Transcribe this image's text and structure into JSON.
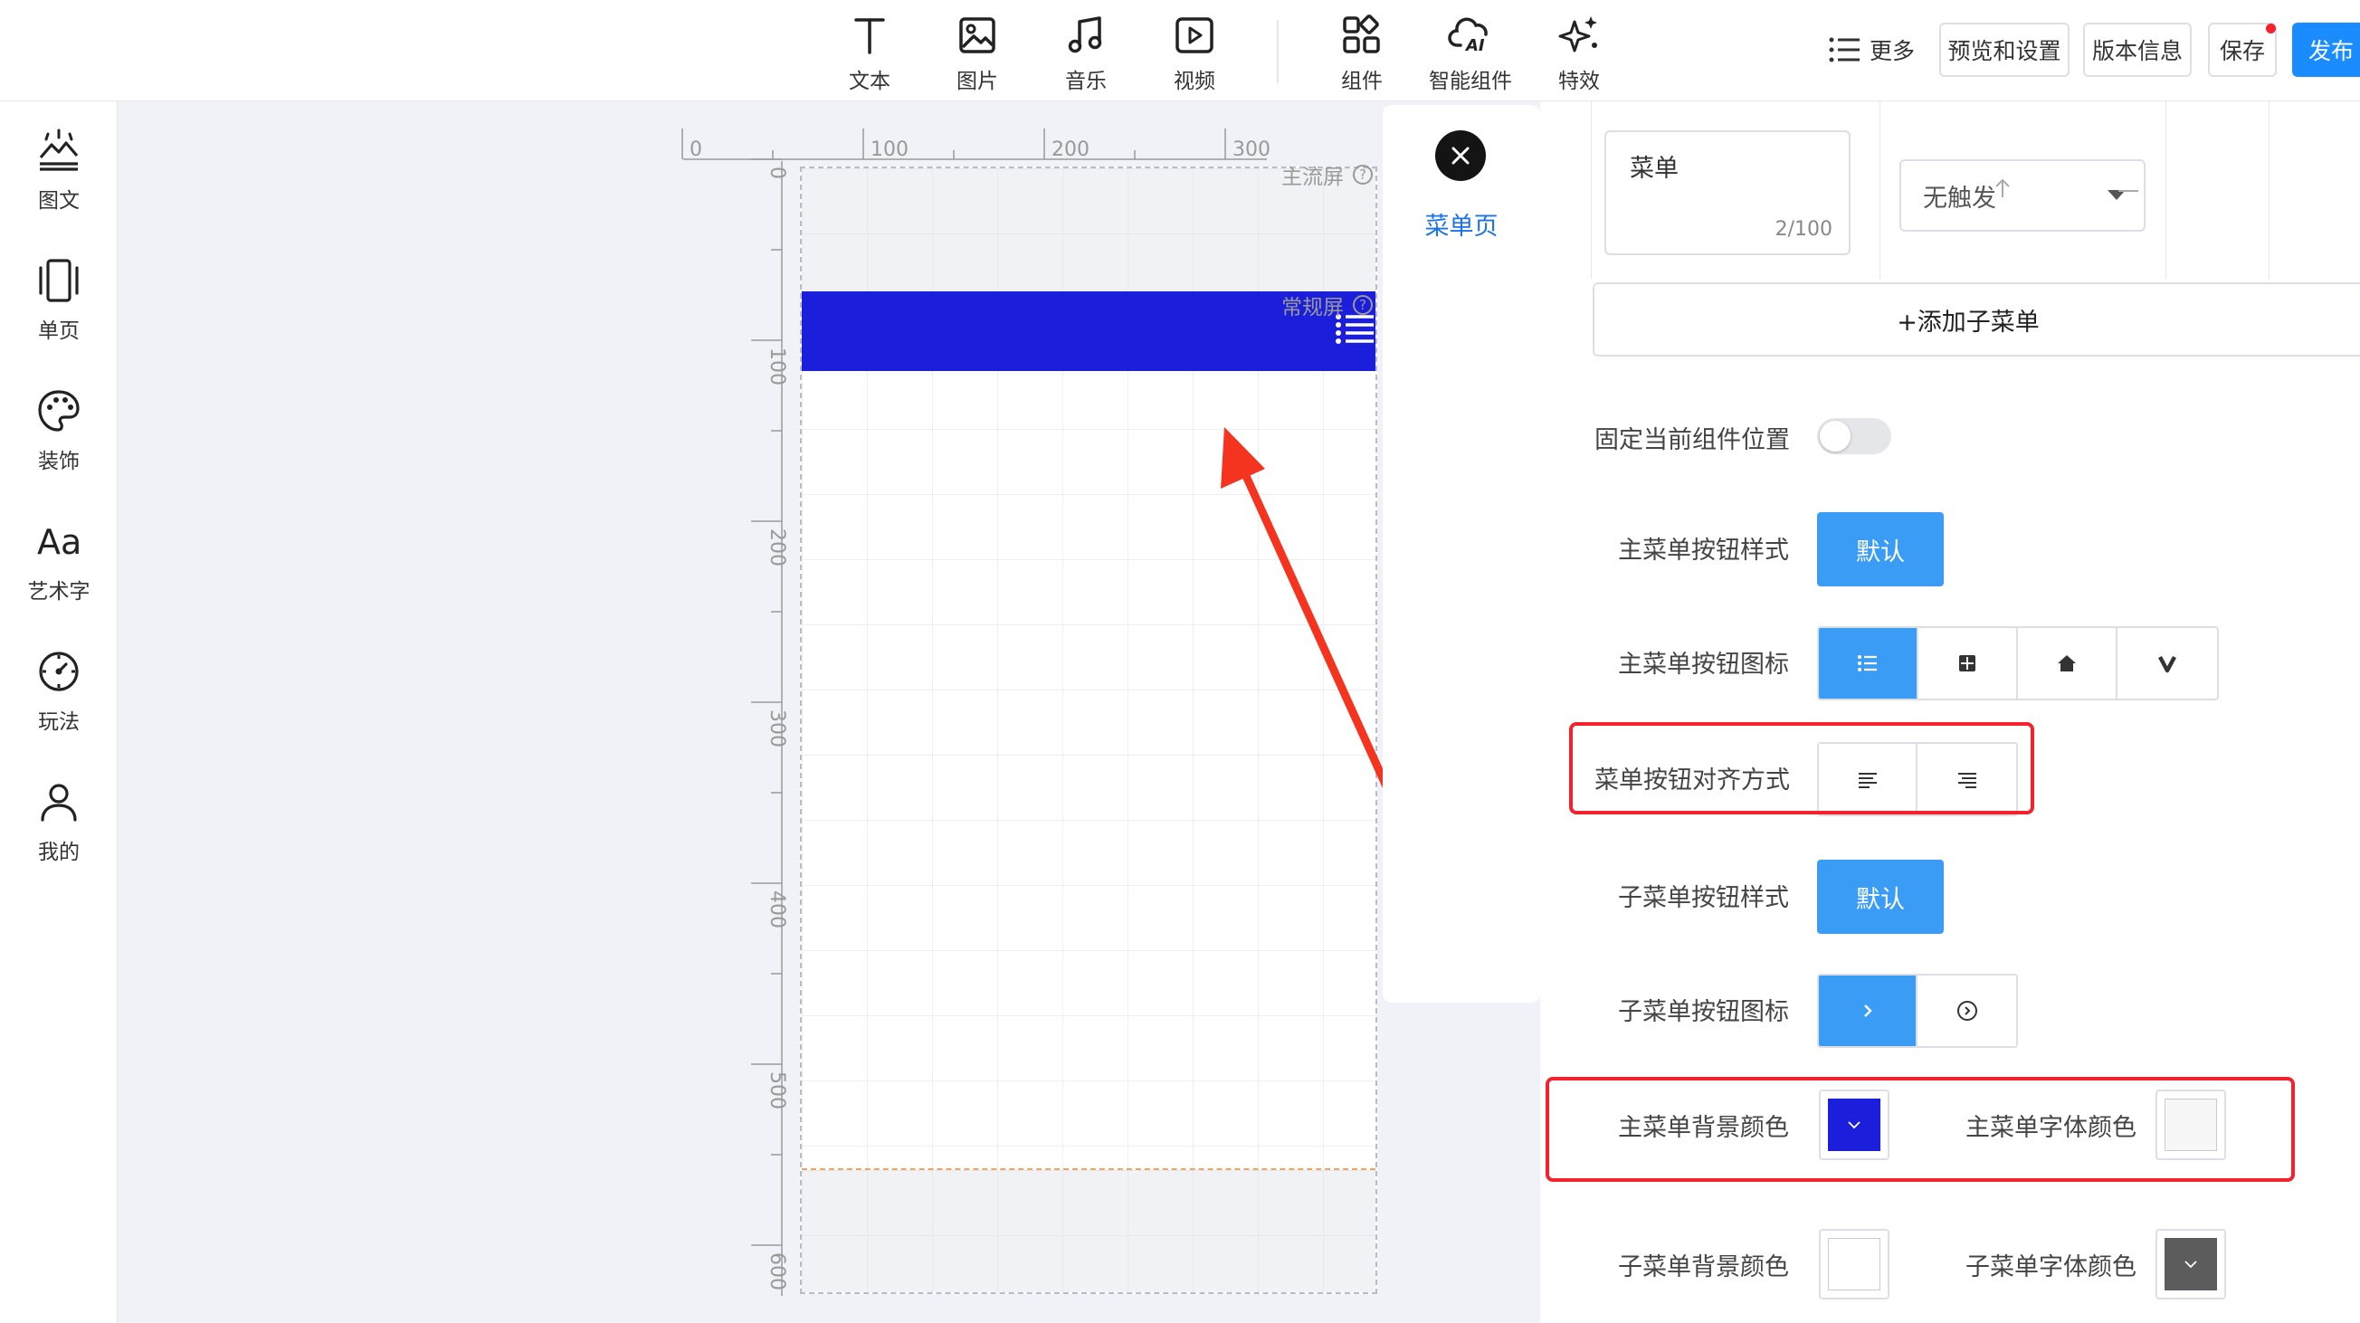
{
  "toolbar": {
    "tools": [
      {
        "icon": "text-icon",
        "label": "文本"
      },
      {
        "icon": "image-icon",
        "label": "图片"
      },
      {
        "icon": "music-icon",
        "label": "音乐"
      },
      {
        "icon": "video-icon",
        "label": "视频"
      },
      {
        "icon": "component-icon",
        "label": "组件"
      },
      {
        "icon": "ai-cloud-icon",
        "label": "智能组件"
      },
      {
        "icon": "sparkle-icon",
        "label": "特效"
      }
    ],
    "more_label": "更多",
    "preview_label": "预览和设置",
    "version_label": "版本信息",
    "save_label": "保存",
    "publish_label": "发布"
  },
  "sidebar": {
    "items": [
      {
        "icon": "image-text-icon",
        "label": "图文"
      },
      {
        "icon": "single-page-icon",
        "label": "单页"
      },
      {
        "icon": "palette-icon",
        "label": "装饰"
      },
      {
        "icon": "art-font-icon",
        "label": "艺术字"
      },
      {
        "icon": "gameplay-icon",
        "label": "玩法"
      },
      {
        "icon": "user-icon",
        "label": "我的"
      }
    ]
  },
  "canvas": {
    "main_screen_label": "主流屏",
    "normal_screen_label": "常规屏",
    "help_glyph": "?"
  },
  "ruler": {
    "h_ticks": [
      "0",
      "100",
      "200",
      "300"
    ],
    "v_ticks": [
      "0",
      "100",
      "200",
      "300",
      "400",
      "500",
      "600"
    ]
  },
  "page_panel": {
    "tab_label": "菜单页"
  },
  "settings": {
    "submenu_name": "菜单",
    "submenu_counter": "2/100",
    "trigger_value": "无触发",
    "add_submenu_label": "+添加子菜单",
    "fix_position_label": "固定当前组件位置",
    "fix_position_on": false,
    "main_btn_style_label": "主菜单按钮样式",
    "main_btn_style_value": "默认",
    "main_btn_icon_label": "主菜单按钮图标",
    "main_btn_icons": [
      "list-icon",
      "grid-icon",
      "home-icon",
      "v-chevron-icon"
    ],
    "align_label": "菜单按钮对齐方式",
    "align_options": [
      "align-left-icon",
      "align-right-icon"
    ],
    "sub_btn_style_label": "子菜单按钮样式",
    "sub_btn_style_value": "默认",
    "sub_btn_icon_label": "子菜单按钮图标",
    "sub_btn_icons": [
      "chevron-right-icon",
      "circle-chevron-icon"
    ],
    "main_bg_color_label": "主菜单背景颜色",
    "main_bg_color": "#1b1edb",
    "main_font_color_label": "主菜单字体颜色",
    "main_font_color": "#f7f7f7",
    "sub_bg_color_label": "子菜单背景颜色",
    "sub_bg_color": "#ffffff",
    "sub_font_color_label": "子菜单字体颜色",
    "sub_font_color": "#5c5c5c"
  },
  "colors": {
    "accent": "#3b9cf5",
    "publish": "#1a8cff",
    "annotation": "#f5222d"
  }
}
